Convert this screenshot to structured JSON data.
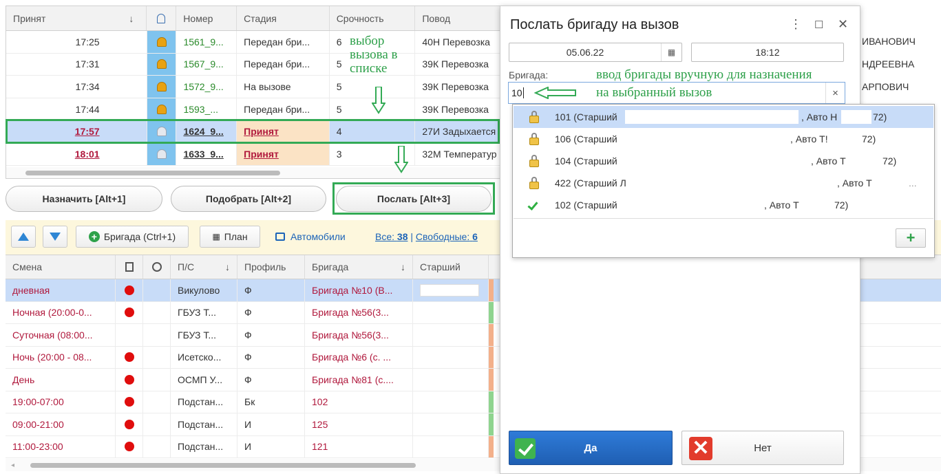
{
  "calls": {
    "headers": [
      "Принят",
      "↓",
      "Номер",
      "Стадия",
      "Срочность",
      "Повод"
    ],
    "rows": [
      {
        "time": "17:25",
        "num": "1561_9...",
        "stage": "Передан бри...",
        "urgency": "6",
        "reason": "40Н Перевозка"
      },
      {
        "time": "17:31",
        "num": "1567_9...",
        "stage": "Передан бри...",
        "urgency": "5",
        "reason": "39К Перевозка"
      },
      {
        "time": "17:34",
        "num": "1572_9...",
        "stage": "На вызове",
        "urgency": "5",
        "reason": "39К Перевозка"
      },
      {
        "time": "17:44",
        "num": "1593_...",
        "stage": "Передан бри...",
        "urgency": "5",
        "reason": "39К Перевозка"
      },
      {
        "time": "17:57",
        "num": "1624_9...",
        "stage": "Принят",
        "urgency": "4",
        "reason": "27И Задыхается"
      },
      {
        "time": "18:01",
        "num": "1633_9...",
        "stage": "Принят",
        "urgency": "3",
        "reason": "32М Температур"
      }
    ]
  },
  "right_col": [
    "ИВАНОВИЧ",
    "НДРЕЕВНА",
    "АРПОВИЧ"
  ],
  "annotations": {
    "select_call": "выбор\nвызова в\nсписке",
    "enter_brigade": "ввод бригады вручную для назначения\nна выбранный вызов"
  },
  "actions": {
    "assign": "Назначить [Alt+1]",
    "pick": "Подобрать [Alt+2]",
    "send": "Послать [Alt+3]"
  },
  "toolbar": {
    "brigade": "Бригада (Ctrl+1)",
    "plan": "План",
    "cars": "Автомобили",
    "all_label": "Все:",
    "all_count": "38",
    "sep": "|",
    "free_label": "Свободные:",
    "free_count": "6"
  },
  "brigades": {
    "headers": {
      "shift": "Смена",
      "ps": "П/С",
      "ps_sort": "↓",
      "profile": "Профиль",
      "brigade": "Бригада",
      "brigade_sort": "↓",
      "senior": "Старший"
    },
    "rows": [
      {
        "shift": "дневная",
        "ps": "Викулово",
        "profile": "Ф",
        "brigade": "Бригада №10 (В...",
        "dot": true,
        "stripe": "#f3b08a"
      },
      {
        "shift": "Ночная (20:00-0...",
        "ps": "ГБУЗ Т...",
        "profile": "Ф",
        "brigade": "Бригада №56(3...",
        "dot": true,
        "stripe": "#8fd48f"
      },
      {
        "shift": "Суточная (08:00...",
        "ps": "ГБУЗ Т...",
        "profile": "Ф",
        "brigade": "Бригада №56(3...",
        "dot": false,
        "stripe": "#f3b08a"
      },
      {
        "shift": "Ночь (20:00 - 08...",
        "ps": "Исетско...",
        "profile": "Ф",
        "brigade": "Бригада №6 (с. ...",
        "dot": true,
        "stripe": "#f3b08a"
      },
      {
        "shift": "День",
        "ps": "ОСМП У...",
        "profile": "Ф",
        "brigade": "Бригада №81 (с....",
        "dot": true,
        "stripe": "#f3b08a"
      },
      {
        "shift": "19:00-07:00",
        "ps": "Подстан...",
        "profile": "Бк",
        "brigade": "102",
        "dot": true,
        "stripe": "#8fd48f"
      },
      {
        "shift": "09:00-21:00",
        "ps": "Подстан...",
        "profile": "И",
        "brigade": "125",
        "dot": true,
        "stripe": "#8fd48f"
      },
      {
        "shift": "11:00-23:00",
        "ps": "Подстан...",
        "profile": "И",
        "brigade": "121",
        "dot": true,
        "stripe": "#f3b08a"
      }
    ]
  },
  "dialog": {
    "title": "Послать бригаду на вызов",
    "date": "05.06.22",
    "time": "18:12",
    "brigade_label": "Бригада:",
    "brigade_value": "10",
    "clear": "×",
    "yes": "Да",
    "no": "Нет"
  },
  "dropdown": {
    "items": [
      {
        "text": "101 (Старший",
        "auto": ", Авто Н",
        "num": "72)",
        "icon": "lock"
      },
      {
        "text": "106 (Старший",
        "auto": ", Авто Т!",
        "num": "72)",
        "icon": "lock"
      },
      {
        "text": "104 (Старший",
        "auto": ", Авто Т",
        "num": "72)",
        "icon": "lock"
      },
      {
        "text": "422 (Старший Л",
        "auto": ", Авто Т",
        "num": "...",
        "icon": "lock"
      },
      {
        "text": "102 (Старший",
        "auto": ", Авто Т",
        "num": "72)",
        "icon": "check"
      }
    ],
    "add": "+"
  }
}
